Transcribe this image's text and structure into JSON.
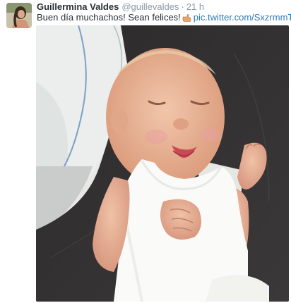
{
  "tweet": {
    "author_name": "Guillermina Valdes",
    "author_handle": "@guillevaldes",
    "separator": "·",
    "timestamp": "21 h",
    "text": "Buen día muchachos! Sean felices!",
    "emoji_icon": "hand-pointing-icon",
    "link_text": "pic.twitter.com/SxzrmmTjLj"
  },
  "colors": {
    "name": "#292f33",
    "meta": "#8899a6",
    "link": "#2b7bb9"
  }
}
